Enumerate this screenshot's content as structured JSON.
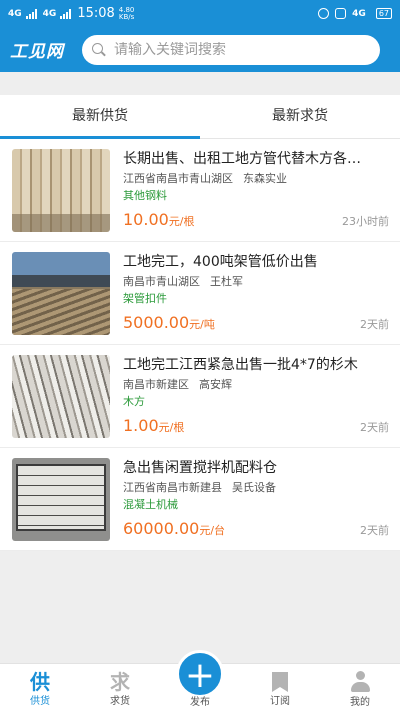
{
  "status_bar": {
    "signal1": "4G",
    "signal2": "4G",
    "time": "15:08",
    "speed_value": "4.80",
    "speed_unit": "KB/s",
    "right_signal": "4G",
    "battery": "67"
  },
  "header": {
    "logo": "工见网",
    "search_placeholder": "请输入关键词搜索"
  },
  "tabs": [
    {
      "label": "最新供货",
      "active": true
    },
    {
      "label": "最新求货",
      "active": false
    }
  ],
  "listings": [
    {
      "title": "长期出售、出租工地方管代替木方各…",
      "location": "江西省南昌市青山湖区",
      "seller": "东森实业",
      "category": "其他钢料",
      "price": "10.00",
      "unit": "元/根",
      "time": "23小时前"
    },
    {
      "title": "工地完工，400吨架管低价出售",
      "location": "南昌市青山湖区",
      "seller": "王杜军",
      "category": "架管扣件",
      "price": "5000.00",
      "unit": "元/吨",
      "time": "2天前"
    },
    {
      "title": "工地完工江西紧急出售一批4*7的杉木",
      "location": "南昌市新建区",
      "seller": "高安辉",
      "category": "木方",
      "price": "1.00",
      "unit": "元/根",
      "time": "2天前"
    },
    {
      "title": "急出售闲置搅拌机配料仓",
      "location": "江西省南昌市新建县",
      "seller": "吴氏设备",
      "category": "混凝土机械",
      "price": "60000.00",
      "unit": "元/台",
      "time": "2天前"
    }
  ],
  "bottom_nav": {
    "supply": {
      "glyph": "供",
      "label": "供货"
    },
    "demand": {
      "glyph": "求",
      "label": "求货"
    },
    "publish": {
      "glyph": "+",
      "label": "发布"
    },
    "subscribe": {
      "label": "订阅"
    },
    "mine": {
      "label": "我的"
    }
  }
}
